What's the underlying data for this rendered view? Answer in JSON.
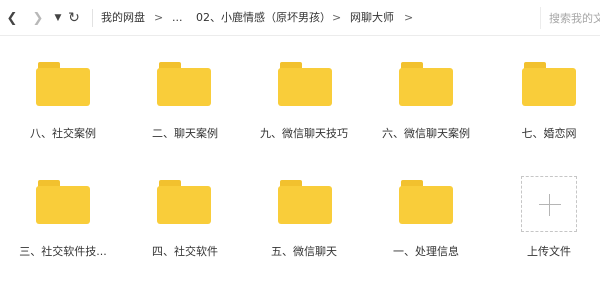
{
  "toolbar": {
    "back_icon": "chevron-left-icon",
    "forward_icon": "chevron-right-icon",
    "dropdown_icon": "caret-down-icon",
    "refresh_icon": "refresh-icon",
    "breadcrumb": [
      "我的网盘",
      "...",
      "02、小鹿情感（原坏男孩）",
      "网聊大师"
    ],
    "breadcrumb_separator": ">",
    "search_placeholder": "搜索我的文件"
  },
  "items": [
    {
      "type": "folder",
      "name": "八、社交案例"
    },
    {
      "type": "folder",
      "name": "二、聊天案例"
    },
    {
      "type": "folder",
      "name": "九、微信聊天技巧"
    },
    {
      "type": "folder",
      "name": "六、微信聊天案例"
    },
    {
      "type": "folder",
      "name": "七、婚恋网"
    },
    {
      "type": "folder",
      "name": "三、社交软件技..."
    },
    {
      "type": "folder",
      "name": "四、社交软件"
    },
    {
      "type": "folder",
      "name": "五、微信聊天"
    },
    {
      "type": "folder",
      "name": "一、处理信息"
    },
    {
      "type": "upload",
      "name": "上传文件"
    }
  ],
  "colors": {
    "folder": "#f9cd3a",
    "folder_tab": "#f2c12e",
    "border": "#ececec"
  }
}
